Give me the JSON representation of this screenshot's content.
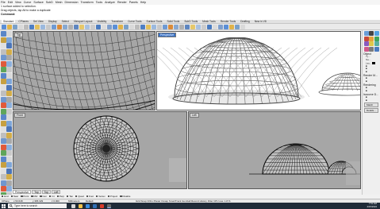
{
  "menu": [
    "File",
    "Edit",
    "View",
    "Curve",
    "Surface",
    "SubD",
    "Mesh",
    "Dimension",
    "Transform",
    "Tools",
    "Analyze",
    "Render",
    "Panels",
    "Help"
  ],
  "command": {
    "line1": "1 surface added to selection.",
    "line2": "Drag objects, tap Alt to make a duplicate",
    "prompt": "Command:"
  },
  "tabs": [
    "Standard",
    "CPlanes",
    "Set View",
    "Display",
    "Select",
    "Viewport Layout",
    "Visibility",
    "Transform",
    "Curve Tools",
    "Surface Tools",
    "Solid Tools",
    "SubD Tools",
    "Mesh Tools",
    "Render Tools",
    "Drafting",
    "New in V8"
  ],
  "active_tab": "Standard",
  "viewports": {
    "top": "Top",
    "perspective": "Perspective",
    "front": "Front",
    "right": "Left"
  },
  "viewport_tabs": [
    "Perspective",
    "Top",
    "Top",
    "Left"
  ],
  "right_panel": {
    "object_header": "Object",
    "rows": [
      "Ty...",
      "Na...",
      "Lay..."
    ],
    "render_header": "Render M...",
    "rendering_header": "Rendering",
    "isocurve_header": "Isocurve D...",
    "match_button": "Match",
    "details_button": "Details..."
  },
  "osnap": [
    "End",
    "Near",
    "Point",
    "Mid",
    "Cen",
    "Int",
    "Perp",
    "Tan",
    "Quad",
    "Knot",
    "Vertex",
    "Project",
    "Disable"
  ],
  "status": {
    "cplane": "CPlane",
    "x": "x 53.648",
    "y": "y 365.329",
    "z": "z 0.000",
    "units": "Millimeters",
    "layer": "Default",
    "modes": "Grid Snap  Ortho  Planar  Osnap  SmartTrack  Gumball  Record History  Filter  CPU use: 1.8 %"
  },
  "taskbar": {
    "search_placeholder": "Type here to search",
    "time": "7:51 AM",
    "date": "4/15/2024"
  },
  "colors": {
    "accent": "#3a72c6",
    "viewport_bg": "#a6a6a6",
    "taskbar": "#1f2b38"
  }
}
